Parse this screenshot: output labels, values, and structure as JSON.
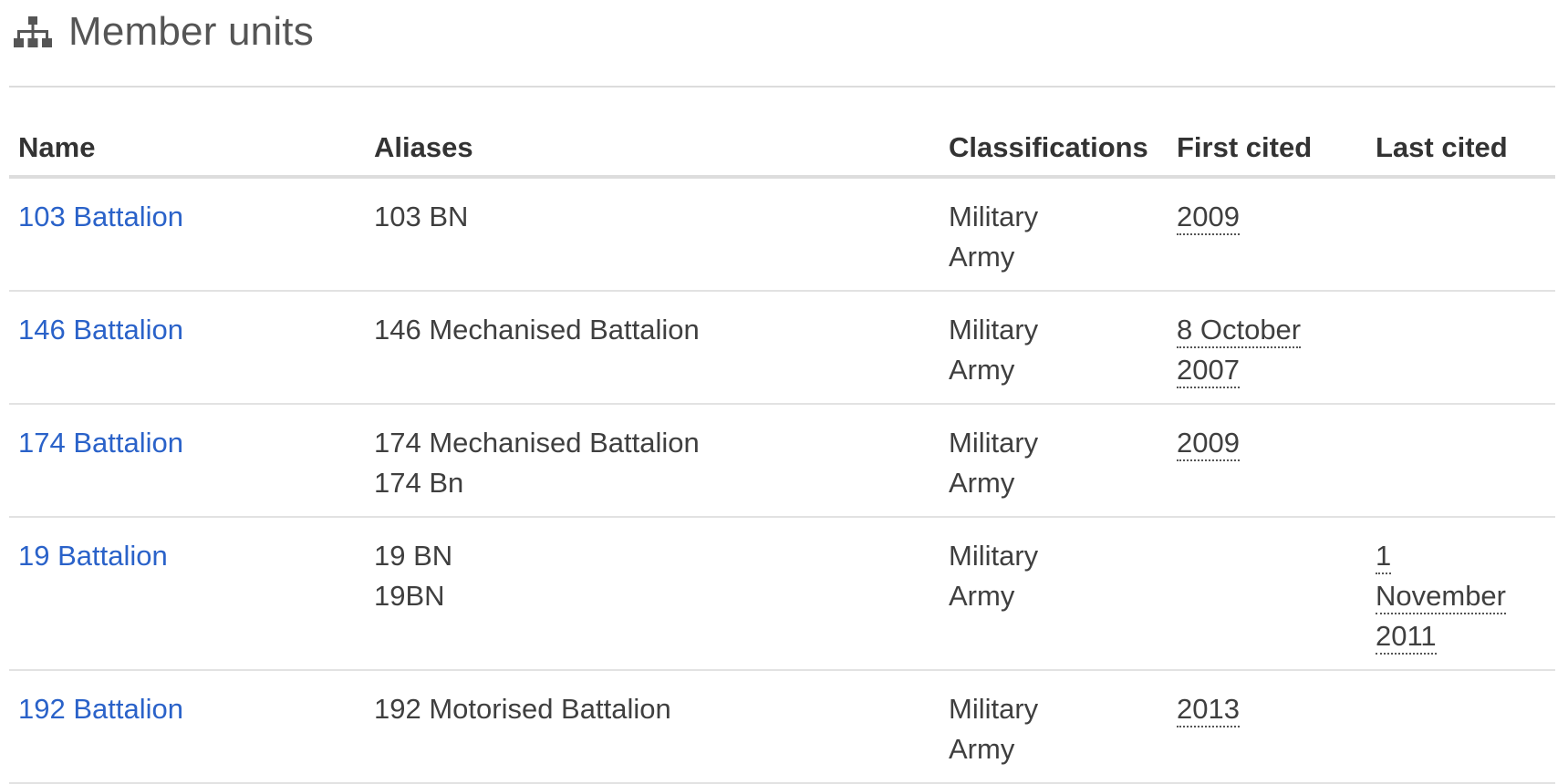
{
  "section": {
    "title": "Member units",
    "icon": "sitemap-icon"
  },
  "table": {
    "headers": {
      "name": "Name",
      "aliases": "Aliases",
      "classifications": "Classifications",
      "first_cited": "First cited",
      "last_cited": "Last cited"
    },
    "rows": [
      {
        "name": "103 Battalion",
        "aliases": [
          "103 BN"
        ],
        "classifications": [
          "Military",
          "Army"
        ],
        "first_cited": [
          "2009"
        ],
        "last_cited": []
      },
      {
        "name": "146 Battalion",
        "aliases": [
          "146 Mechanised Battalion"
        ],
        "classifications": [
          "Military",
          "Army"
        ],
        "first_cited": [
          "8 October",
          "2007"
        ],
        "last_cited": []
      },
      {
        "name": "174 Battalion",
        "aliases": [
          "174 Mechanised Battalion",
          "174 Bn"
        ],
        "classifications": [
          "Military",
          "Army"
        ],
        "first_cited": [
          "2009"
        ],
        "last_cited": []
      },
      {
        "name": "19 Battalion",
        "aliases": [
          "19 BN",
          "19BN"
        ],
        "classifications": [
          "Military",
          "Army"
        ],
        "first_cited": [],
        "last_cited": [
          "1",
          "November",
          "2011"
        ]
      },
      {
        "name": "192 Battalion",
        "aliases": [
          "192 Motorised Battalion"
        ],
        "classifications": [
          "Military",
          "Army"
        ],
        "first_cited": [
          "2013"
        ],
        "last_cited": []
      }
    ]
  },
  "colors": {
    "link": "#2a62c9",
    "text": "#3f3f3f",
    "heading": "#555555"
  }
}
